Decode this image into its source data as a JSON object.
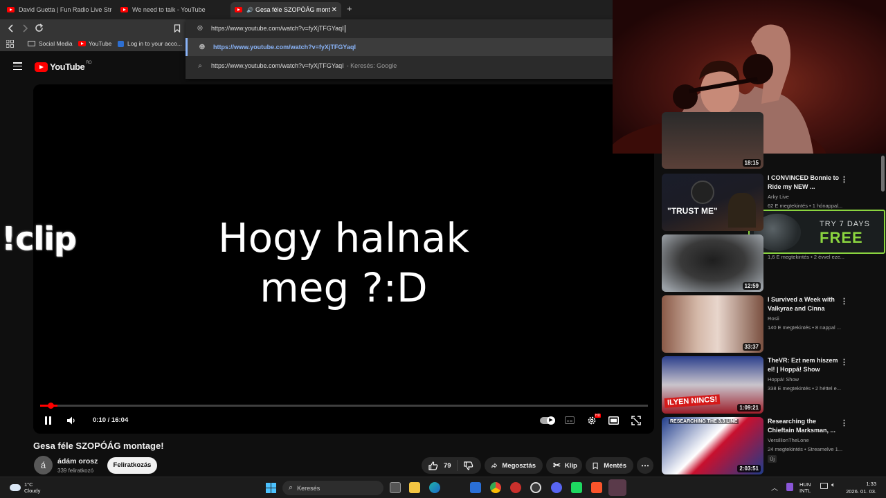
{
  "browser": {
    "tabs": [
      {
        "label": "David Guetta | Fun Radio Live Stream"
      },
      {
        "label": "We need to talk - YouTube"
      },
      {
        "label": "Gesa féle SZOPÓÁG montage"
      }
    ],
    "address": "https://www.youtube.com/watch?v=fyXjTFGYaqI",
    "bookmarks": [
      "Social Media",
      "YouTube",
      "Log in to your acco..."
    ],
    "suggestions": [
      {
        "text": "https://www.youtube.com/watch?v=fyXjTFGYaqI",
        "suffix": ""
      },
      {
        "text": "https://www.youtube.com/watch?v=fyXjTFGYaqI",
        "suffix": "- Keresés: Google"
      }
    ]
  },
  "youtube": {
    "logo_text": "YouTube",
    "region": "RO"
  },
  "player": {
    "video_text_line1": "Hogy halnak",
    "video_text_line2": "meg ?:D",
    "overlay_text": "!clip",
    "time": "0:10 / 16:04",
    "progress_fraction": 0.0104
  },
  "video": {
    "title": "Gesa féle SZOPÓÁG montage!",
    "channel": "ádám orosz",
    "avatar_letter": "á",
    "subscribers": "339 feliratkozó",
    "subscribe_label": "Feliratkozás",
    "likes": "79",
    "share_label": "Megosztás",
    "clip_label": "Klip",
    "save_label": "Mentés"
  },
  "ad": {
    "line1": "TRY 7 DAYS",
    "line2": "FREE"
  },
  "recommendations": [
    {
      "title": "",
      "channel": "",
      "meta": "",
      "duration": "18:15"
    },
    {
      "title": "I CONVINCED Bonnie to Ride my NEW ...",
      "channel": "Arky Live",
      "meta": "62 E megtekintés • 1 hónappal...",
      "duration": "",
      "thumb_text": "\"TRUST ME\""
    },
    {
      "title": "",
      "channel": "",
      "meta": "1,6 E megtekintés • 2 évvel eze...",
      "duration": "12:59"
    },
    {
      "title": "I Survived a Week with Valkyrae and Cinna",
      "channel": "Rosii",
      "meta": "140 E megtekintés • 8 nappal ...",
      "duration": "33:37"
    },
    {
      "title": "TheVR: Ezt nem hiszem el! | Hoppá! Show",
      "channel": "Hoppá! Show",
      "meta": "338 E megtekintés • 2 héttel e...",
      "duration": "1:09:21",
      "thumb_text": "ILYEN NINCS!"
    },
    {
      "title": "Researching the Chieftain Marksman, ...",
      "channel": "VersillionTheLone",
      "meta": "24 megtekintés • Streamelve 1...",
      "duration": "2:03:51",
      "badge": "Új",
      "thumb_text": "RESEARCHING THE 3.3 LINE"
    }
  ],
  "taskbar": {
    "weather_temp": "1°C",
    "weather_desc": "Cloudy",
    "search_label": "Keresés",
    "lang1": "HUN",
    "lang2": "INTL",
    "time": "1:33",
    "date": "2026. 01. 03."
  },
  "colors": {
    "youtube_red": "#ff0000",
    "ad_green": "#8bd43f",
    "link_blue": "#8ab4f8"
  }
}
